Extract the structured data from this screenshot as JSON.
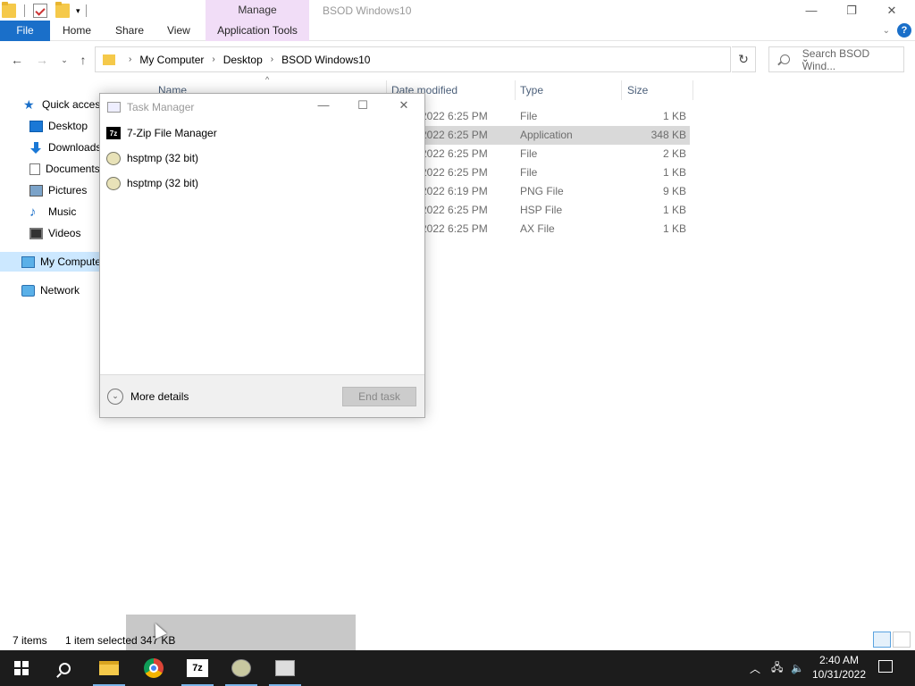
{
  "titlebar": {
    "manage_label": "Manage",
    "window_title": "BSOD Windows10",
    "minimize": "—",
    "restore": "❐",
    "close": "✕"
  },
  "ribbon": {
    "tabs": [
      "File",
      "Home",
      "Share",
      "View",
      "Application Tools"
    ],
    "help": "?"
  },
  "address": {
    "breadcrumb": [
      "My Computer",
      "Desktop",
      "BSOD Windows10"
    ],
    "search_placeholder": "Search BSOD Wind..."
  },
  "nav": {
    "items": [
      {
        "label": "Quick access",
        "icon": "star-icon"
      },
      {
        "label": "Desktop",
        "icon": "desktop-icon"
      },
      {
        "label": "Downloads",
        "icon": "download-icon"
      },
      {
        "label": "Documents",
        "icon": "documents-icon"
      },
      {
        "label": "Pictures",
        "icon": "pictures-icon"
      },
      {
        "label": "Music",
        "icon": "music-icon"
      },
      {
        "label": "Videos",
        "icon": "videos-icon"
      },
      {
        "label": "My Computer",
        "icon": "computer-icon"
      },
      {
        "label": "Network",
        "icon": "network-icon"
      }
    ]
  },
  "columns": {
    "name": "Name",
    "date": "Date modified",
    "type": "Type",
    "size": "Size"
  },
  "files": [
    {
      "date": "2022 6:25 PM",
      "type": "File",
      "size": "1 KB",
      "selected": false
    },
    {
      "date": "2022 6:25 PM",
      "type": "Application",
      "size": "348 KB",
      "selected": true
    },
    {
      "date": "2022 6:25 PM",
      "type": "File",
      "size": "2 KB",
      "selected": false
    },
    {
      "date": "2022 6:25 PM",
      "type": "File",
      "size": "1 KB",
      "selected": false
    },
    {
      "date": "2022 6:19 PM",
      "type": "PNG File",
      "size": "9 KB",
      "selected": false
    },
    {
      "date": "2022 6:25 PM",
      "type": "HSP File",
      "size": "1 KB",
      "selected": false
    },
    {
      "date": "2022 6:25 PM",
      "type": "AX File",
      "size": "1 KB",
      "selected": false
    }
  ],
  "status": {
    "count": "7 items",
    "selected": "1 item selected",
    "size": "347 KB"
  },
  "task_manager": {
    "title": "Task Manager",
    "processes": [
      {
        "name": "7-Zip File Manager",
        "icon": "7zip-icon"
      },
      {
        "name": "hsptmp (32 bit)",
        "icon": "hsp-icon"
      },
      {
        "name": "hsptmp (32 bit)",
        "icon": "hsp-icon"
      }
    ],
    "more_details": "More details",
    "end_task": "End task"
  },
  "taskbar": {
    "time": "2:40 AM",
    "date": "10/31/2022",
    "apps": [
      "windows-start",
      "search",
      "file-explorer",
      "chrome",
      "7zip",
      "hsp",
      "task-manager"
    ]
  },
  "colors": {
    "accent": "#1a6fc9",
    "manage_tab": "#f1ddf7",
    "selection": "#cce8ff",
    "taskbar": "#1c1c1c"
  }
}
